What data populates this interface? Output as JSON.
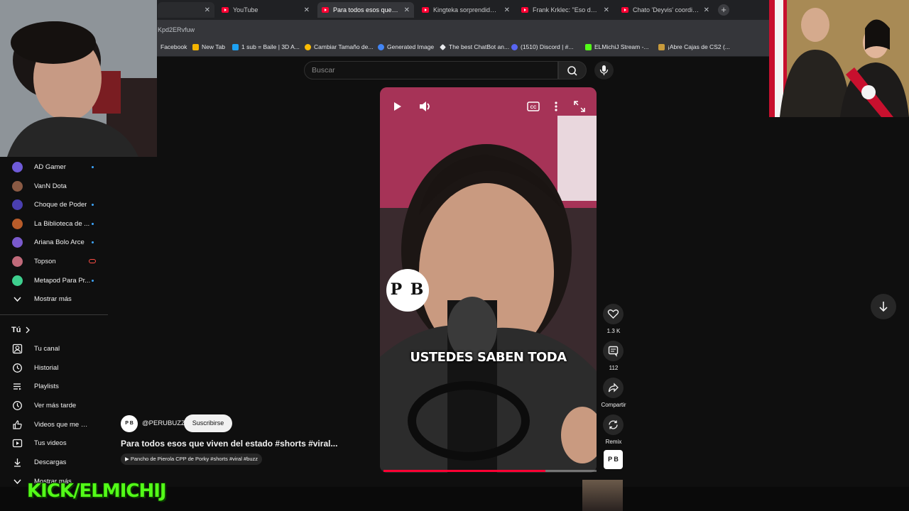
{
  "browser": {
    "tabs": [
      {
        "title": "YouTube",
        "active": false
      },
      {
        "title": "Para todos esos que viven",
        "active": true
      },
      {
        "title": "Kingteka sorprendido: Ci",
        "active": false
      },
      {
        "title": "Frank Krklec: \"Eso de que",
        "active": false
      },
      {
        "title": "Chato 'Deyvis' coordinaba",
        "active": false
      }
    ],
    "new_tab": "+",
    "url_fragment": "Kpd2ERvfuw",
    "bookmarks": [
      {
        "label": "Facebook",
        "color": "#1877f2"
      },
      {
        "label": "New Tab",
        "color": "#f4b400"
      },
      {
        "label": "1 sub = Baile | 3D A...",
        "color": "#53fc18"
      },
      {
        "label": "Cambiar Tamaño de...",
        "color": "#1da1f2"
      },
      {
        "label": "Generated Image",
        "color": "#ea4335"
      },
      {
        "label": "The best ChatBot an...",
        "color": "#9aa0a6"
      },
      {
        "label": "(1510) Discord | #...",
        "color": "#ffffff"
      },
      {
        "label": "ELMichiJ Stream -...",
        "color": "#5865f2"
      },
      {
        "label": "¡Abre Cajas de CS2 (...",
        "color": "#53fc18"
      }
    ]
  },
  "search": {
    "placeholder": "Buscar"
  },
  "sidebar": {
    "subscriptions": [
      {
        "label": "AD Gamer",
        "color": "#6f5bd8",
        "live": false,
        "dot": true
      },
      {
        "label": "VanN Dota",
        "color": "#8a5a44",
        "live": false,
        "dot": false
      },
      {
        "label": "Choque de Poder",
        "color": "#4a3fb0",
        "live": false,
        "dot": true
      },
      {
        "label": "La Biblioteca de ...",
        "color": "#b85c2a",
        "live": false,
        "dot": true
      },
      {
        "label": "Ariana Bolo Arce",
        "color": "#7a5acd",
        "live": false,
        "dot": true
      },
      {
        "label": "Topson",
        "color": "#c06a7a",
        "live": true,
        "dot": false
      },
      {
        "label": "Metapod Para Pr...",
        "color": "#3ecf8e",
        "live": false,
        "dot": true
      }
    ],
    "show_more": "Mostrar más",
    "you_header": "Tú",
    "you_items": [
      {
        "label": "Tu canal",
        "icon": "account-icon"
      },
      {
        "label": "Historial",
        "icon": "history-icon"
      },
      {
        "label": "Playlists",
        "icon": "playlist-icon"
      },
      {
        "label": "Ver más tarde",
        "icon": "clock-icon"
      },
      {
        "label": "Videos que me gus...",
        "icon": "thumb-up-icon"
      },
      {
        "label": "Tus videos",
        "icon": "video-icon"
      },
      {
        "label": "Descargas",
        "icon": "download-icon"
      }
    ],
    "show_more_2": "Mostrar más"
  },
  "video": {
    "caption": "USTEDES SABEN TODA",
    "logo_text": "P B",
    "progress_fraction": 0.76,
    "actions": {
      "likes": "1.3 K",
      "comments": "112",
      "share": "Compartir",
      "remix": "Remix"
    },
    "channel": {
      "avatar_text": "P B",
      "handle": "@PERUBUZZ",
      "subscribe": "Suscribirse"
    },
    "title": "Para todos esos que viven del estado #shorts #viral...",
    "sound": "Pancho de Pierola CPP de Porky #shorts #viral #buzz"
  },
  "overlay": {
    "kick_text": "KICK/ELMICHIJ"
  }
}
